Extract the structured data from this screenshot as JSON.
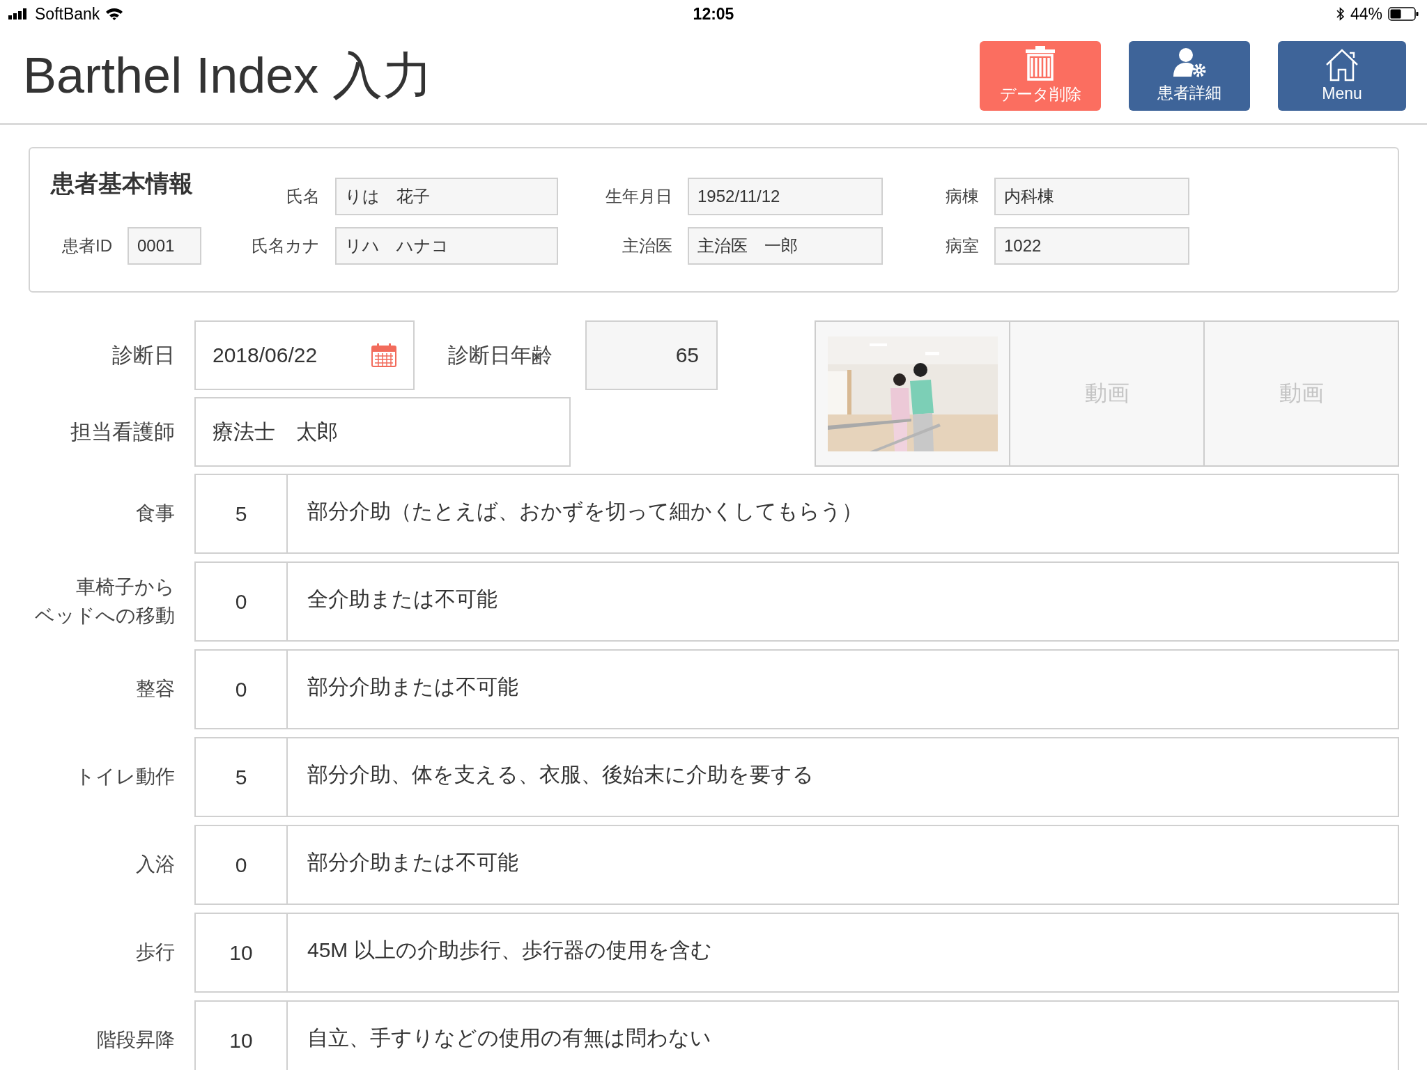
{
  "status_bar": {
    "carrier": "SoftBank",
    "time": "12:05",
    "battery": "44%"
  },
  "header": {
    "title": "Barthel Index 入力",
    "buttons": [
      {
        "kind": "delete",
        "label": "データ削除"
      },
      {
        "kind": "patient",
        "label": "患者詳細"
      },
      {
        "kind": "menu",
        "label": "Menu"
      }
    ]
  },
  "patient_info": {
    "title": "患者基本情報",
    "patient_id": {
      "label": "患者ID",
      "value": "0001"
    },
    "rows": [
      [
        {
          "label": "氏名",
          "value": "りは　花子"
        },
        {
          "label": "生年月日",
          "value": "1952/11/12"
        },
        {
          "label": "病棟",
          "value": "内科棟"
        }
      ],
      [
        {
          "label": "氏名カナ",
          "value": "リハ　ハナコ"
        },
        {
          "label": "主治医",
          "value": "主治医　一郎"
        },
        {
          "label": "病室",
          "value": "1022"
        }
      ]
    ]
  },
  "diagnosis": {
    "date": {
      "label": "診断日",
      "value": "2018/06/22"
    },
    "age": {
      "label": "診断日年齢",
      "value": "65"
    },
    "nurse": {
      "label": "担当看護師",
      "value": "療法士　太郎"
    }
  },
  "media": [
    {
      "kind": "picture"
    },
    {
      "kind": "video",
      "label": "動画"
    },
    {
      "kind": "video",
      "label": "動画"
    }
  ],
  "scores": [
    {
      "item": [
        "食事"
      ],
      "score": "5",
      "description": "部分介助（たとえば、おかずを切って細かくしてもらう）"
    },
    {
      "item": [
        "車椅子から",
        "ベッドへの移動"
      ],
      "score": "0",
      "description": "全介助または不可能"
    },
    {
      "item": [
        "整容"
      ],
      "score": "0",
      "description": "部分介助または不可能"
    },
    {
      "item": [
        "トイレ動作"
      ],
      "score": "5",
      "description": "部分介助、体を支える、衣服、後始末に介助を要する"
    },
    {
      "item": [
        "入浴"
      ],
      "score": "0",
      "description": "部分介助または不可能"
    },
    {
      "item": [
        "歩行"
      ],
      "score": "10",
      "description": "45M 以上の介助歩行、歩行器の使用を含む"
    },
    {
      "item": [
        "階段昇降"
      ],
      "score": "10",
      "description": "自立、手すりなどの使用の有無は問わない"
    }
  ]
}
